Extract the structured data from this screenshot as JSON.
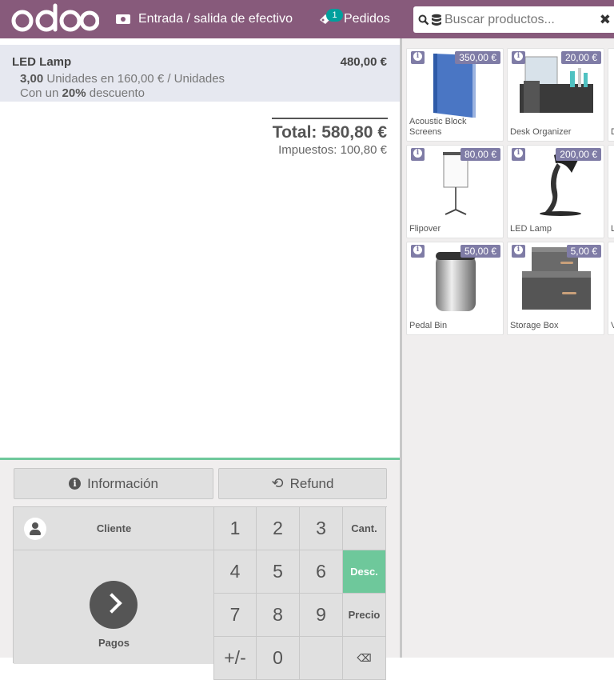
{
  "header": {
    "logo_text": "odoo",
    "cash_label": "Entrada / salida de efectivo",
    "orders_label": "Pedidos",
    "orders_count": "1",
    "search_placeholder": "Buscar productos...",
    "brand_color": "#875a7b"
  },
  "order": {
    "line": {
      "name": "LED Lamp",
      "price": "480,00 €",
      "qty": "3,00",
      "unit_text": "Unidades en 160,00 € / Unidades",
      "discount_prefix": "Con un",
      "discount_value": "20%",
      "discount_suffix": "descuento"
    },
    "total_label": "Total:",
    "total_value": "580,80 €",
    "taxes_label": "Impuestos:",
    "taxes_value": "100,80 €"
  },
  "controls": {
    "info_label": "Información",
    "refund_label": "Refund",
    "client_label": "Cliente",
    "pay_label": "Pagos",
    "keys": [
      "1",
      "2",
      "3",
      "Cant.",
      "4",
      "5",
      "6",
      "Desc.",
      "7",
      "8",
      "9",
      "Precio",
      "+/-",
      "0",
      "",
      "⌫"
    ],
    "active_mode": "Desc.",
    "accent_color": "#6ec89b"
  },
  "products": [
    {
      "name": "Acoustic Block Screens",
      "price": "350,00 €"
    },
    {
      "name": "Desk Organizer",
      "price": "20,00 €"
    },
    {
      "name": "Flipover",
      "price": "80,00 €"
    },
    {
      "name": "LED Lamp",
      "price": "200,00 €"
    },
    {
      "name": "Pedal Bin",
      "price": "50,00 €"
    },
    {
      "name": "Storage Box",
      "price": "5,00 €"
    }
  ],
  "partial_products": [
    {
      "name": "D"
    },
    {
      "name": "L"
    },
    {
      "name": "V"
    }
  ]
}
